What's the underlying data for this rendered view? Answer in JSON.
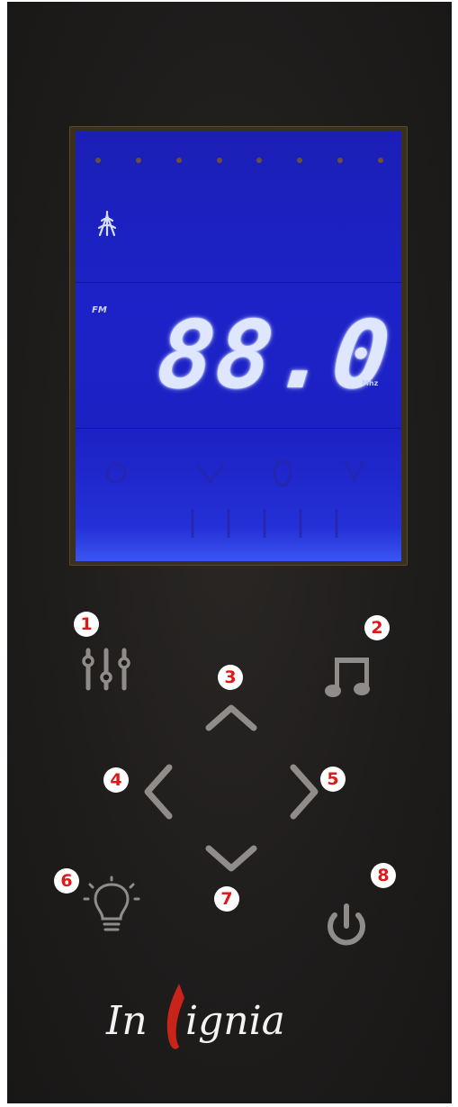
{
  "display": {
    "band": "FM",
    "frequency": "88.0",
    "unit": "Mhz"
  },
  "buttons": {
    "equalizer": {
      "badge": "1",
      "icon": "equalizer-sliders-icon"
    },
    "music": {
      "badge": "2",
      "icon": "music-note-icon"
    },
    "up": {
      "badge": "3",
      "icon": "chevron-up-icon"
    },
    "left": {
      "badge": "4",
      "icon": "chevron-left-icon"
    },
    "right": {
      "badge": "5",
      "icon": "chevron-right-icon"
    },
    "light": {
      "badge": "6",
      "icon": "lightbulb-icon"
    },
    "down": {
      "badge": "7",
      "icon": "chevron-down-icon"
    },
    "power": {
      "badge": "8",
      "icon": "power-icon"
    }
  },
  "brand": {
    "prefix": "In",
    "suffix": "ignia"
  },
  "colors": {
    "lcd_blue": "#1d22c8",
    "digit_glow": "#dfe7ff",
    "button_gray": "#8f8c89",
    "badge_red": "#e01818",
    "flame_red": "#c8241a"
  }
}
